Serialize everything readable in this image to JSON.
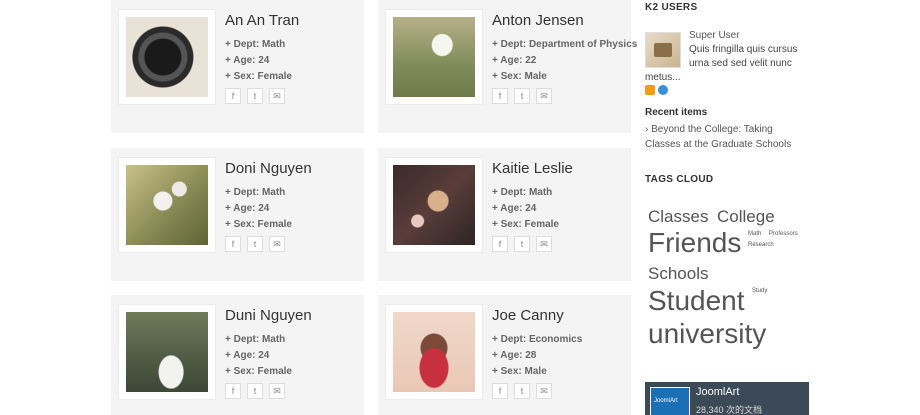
{
  "people": [
    {
      "name": "An An Tran",
      "dept_label": "+ Dept:",
      "dept": "Math",
      "age_label": "+ Age:",
      "age": "24",
      "sex_label": "+ Sex:",
      "sex": "Female",
      "image": "camera-lens-photo"
    },
    {
      "name": "Anton Jensen",
      "dept_label": "+ Dept:",
      "dept": "Department of Physics",
      "age_label": "+ Age:",
      "age": "22",
      "sex_label": "+ Sex:",
      "sex": "Male",
      "image": "white-flower-photo"
    },
    {
      "name": "Doni Nguyen",
      "dept_label": "+ Dept:",
      "dept": "Math",
      "age_label": "+ Age:",
      "age": "24",
      "sex_label": "+ Sex:",
      "sex": "Female",
      "image": "blossom-branch-photo"
    },
    {
      "name": "Kaitie Leslie",
      "dept_label": "+ Dept:",
      "dept": "Math",
      "age_label": "+ Age:",
      "age": "24",
      "sex_label": "+ Sex:",
      "sex": "Female",
      "image": "christmas-tree-photo"
    },
    {
      "name": "Duni Nguyen",
      "dept_label": "+ Dept:",
      "dept": "Math",
      "age_label": "+ Age:",
      "age": "24",
      "sex_label": "+ Sex:",
      "sex": "Female",
      "image": "swan-photo"
    },
    {
      "name": "Joe Canny",
      "dept_label": "+ Dept:",
      "dept": "Economics",
      "age_label": "+ Age:",
      "age": "28",
      "sex_label": "+ Sex:",
      "sex": "Male",
      "image": "cupcake-photo"
    }
  ],
  "social_icons": [
    "facebook-icon",
    "twitter-icon",
    "email-icon"
  ],
  "sidebar": {
    "k2_users_title": "K2 USERS",
    "k2_user": {
      "name": "Super User",
      "desc": "Quis fringilla quis cursus urna sed sed velit nunc",
      "more": "metus..."
    },
    "recent_title": "Recent items",
    "recent_item": "Beyond the College: Taking Classes at the Graduate Schools",
    "tags_title": "TAGS CLOUD",
    "tags": {
      "classes": "Classes",
      "college": "College",
      "friends": "Friends",
      "math": "Math",
      "professors": "Professors",
      "research": "Research",
      "schools": "Schools",
      "student": "Student",
      "study": "Study",
      "university": "university"
    },
    "banner": {
      "title": "JoomlArt",
      "subtitle": "28,340 次的文档",
      "logo": "JoomlArt"
    }
  },
  "colors": {
    "card_bg": "#f4f4f4",
    "text": "#333333",
    "banner_bg": "#3c4a57"
  }
}
